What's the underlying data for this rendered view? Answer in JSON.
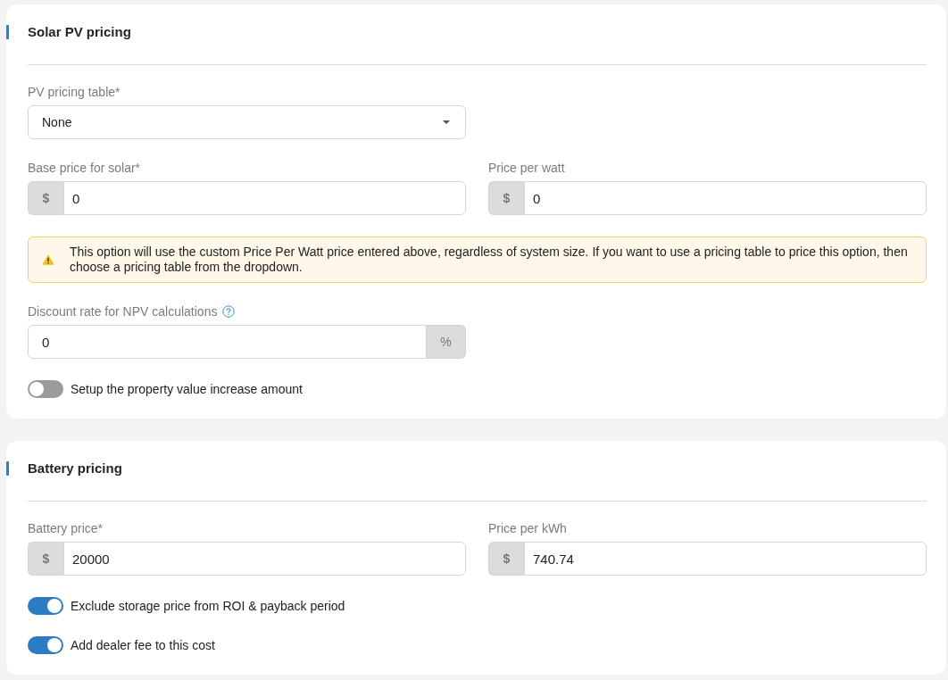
{
  "sections": [
    {
      "title": "Solar PV pricing",
      "rows": [
        {
          "fields": [
            {
              "kind": "select",
              "label": "PV pricing table*",
              "value": "None"
            }
          ]
        },
        {
          "fields": [
            {
              "kind": "input",
              "label": "Base price for solar*",
              "prefix": "$",
              "value": "0"
            },
            {
              "kind": "input",
              "label": "Price per watt",
              "prefix": "$",
              "value": "0"
            }
          ]
        },
        {
          "fields": [
            {
              "kind": "notice",
              "text": "This option will use the custom Price Per Watt price entered above, regardless of system size. If you want to use a pricing table to price this option, then choose a pricing table from the dropdown."
            }
          ]
        },
        {
          "fields": [
            {
              "kind": "input",
              "label": "Discount rate for NPV calculations",
              "help": true,
              "suffix": "%",
              "value": "0"
            }
          ]
        },
        {
          "fields": [
            {
              "kind": "toggle",
              "label": "Setup the property value increase amount",
              "on": false
            }
          ]
        }
      ]
    },
    {
      "title": "Battery pricing",
      "rows": [
        {
          "fields": [
            {
              "kind": "input",
              "label": "Battery price*",
              "prefix": "$",
              "value": "20000"
            },
            {
              "kind": "input",
              "label": "Price per kWh",
              "prefix": "$",
              "value": "740.74"
            }
          ]
        },
        {
          "fields": [
            {
              "kind": "toggle",
              "label": "Exclude storage price from ROI & payback period",
              "on": true
            }
          ]
        },
        {
          "fields": [
            {
              "kind": "toggle",
              "label": "Add dealer fee to this cost",
              "on": true
            }
          ]
        }
      ]
    }
  ]
}
